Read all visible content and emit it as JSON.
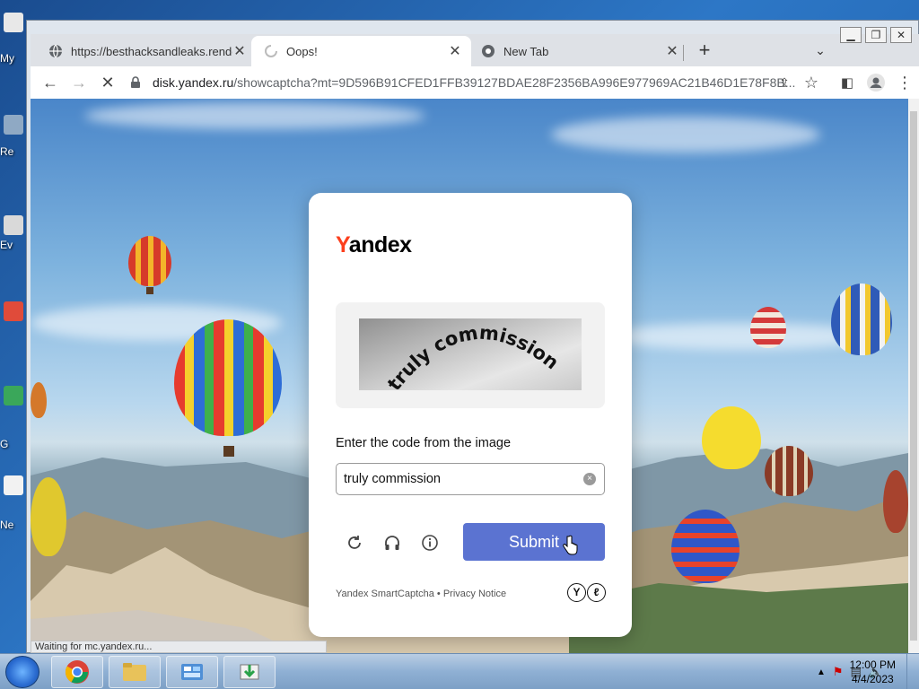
{
  "desktop": {
    "icons": [
      {
        "label": "My"
      },
      {
        "label": "Re"
      },
      {
        "label": "Ev"
      },
      {
        "label": "G"
      },
      {
        "label": "Ne"
      }
    ]
  },
  "browser": {
    "tabs": [
      {
        "title": "https://besthacksandleaks.rende",
        "active": false
      },
      {
        "title": "Oops!",
        "active": true,
        "loading": true
      },
      {
        "title": "New Tab",
        "active": false
      }
    ],
    "new_tab_label": "+",
    "address": {
      "host": "disk.yandex.ru",
      "path": "/showcaptcha?mt=9D596B91CFED1FFB39127BDAE28F2356BA996E977969AC21B46D1E78F8B..."
    },
    "status_text": "Waiting for mc.yandex.ru..."
  },
  "captcha": {
    "brand": {
      "first_letter": "Y",
      "rest": "andex"
    },
    "image_text": "truly commission",
    "prompt": "Enter the code from the image",
    "input_value": "truly commission",
    "clear_glyph": "×",
    "submit_label": "Submit",
    "footer": {
      "product": "Yandex SmartCaptcha",
      "separator": "•",
      "privacy": "Privacy Notice"
    },
    "logo_letters": [
      "Y",
      "ℓ"
    ]
  },
  "taskbar": {
    "time": "12:00 PM",
    "date": "4/4/2023"
  },
  "colors": {
    "submit": "#5b73d1",
    "brand_accent": "#fc3f1d"
  }
}
